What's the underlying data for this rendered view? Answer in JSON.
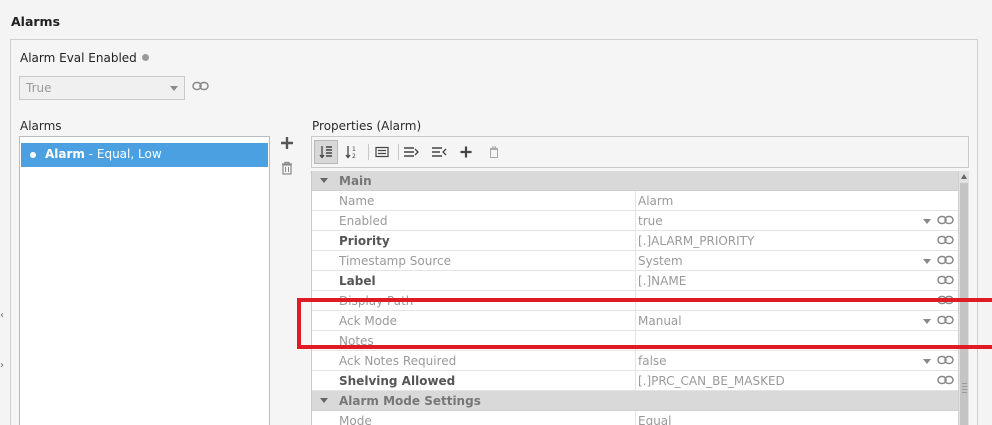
{
  "section_title": "Alarms",
  "alarm_eval": {
    "label": "Alarm Eval Enabled",
    "value": "True"
  },
  "alarms": {
    "label": "Alarms",
    "items": [
      {
        "name": "Alarm",
        "detail": " - Equal, Low"
      }
    ]
  },
  "properties": {
    "label": "Properties (Alarm)",
    "categories": [
      {
        "title": "Main"
      },
      {
        "title": "Alarm Mode Settings"
      }
    ],
    "rows": [
      {
        "name": "Name",
        "value": "Alarm",
        "bold": false,
        "dropdown": false,
        "link": false
      },
      {
        "name": "Enabled",
        "value": "true",
        "bold": false,
        "dropdown": true,
        "link": true
      },
      {
        "name": "Priority",
        "value": "[.]ALARM_PRIORITY",
        "bold": true,
        "dropdown": false,
        "link": true
      },
      {
        "name": "Timestamp Source",
        "value": "System",
        "bold": false,
        "dropdown": true,
        "link": true
      },
      {
        "name": "Label",
        "value": "[.]NAME",
        "bold": true,
        "dropdown": false,
        "link": true
      },
      {
        "name": "Display Path",
        "value": "",
        "bold": false,
        "dropdown": false,
        "link": true
      },
      {
        "name": "Ack Mode",
        "value": "Manual",
        "bold": false,
        "dropdown": true,
        "link": true
      },
      {
        "name": "Notes",
        "value": "",
        "bold": false,
        "dropdown": false,
        "link": false
      },
      {
        "name": "Ack Notes Required",
        "value": "false",
        "bold": false,
        "dropdown": true,
        "link": true
      },
      {
        "name": "Shelving Allowed",
        "value": "[.]PRC_CAN_BE_MASKED",
        "bold": true,
        "dropdown": false,
        "link": true
      },
      {
        "name": "Mode",
        "value": "Equal",
        "bold": false,
        "dropdown": false,
        "link": false
      }
    ]
  },
  "colors": {
    "selection": "#4aa0e1",
    "highlight_box": "#e01b24"
  }
}
